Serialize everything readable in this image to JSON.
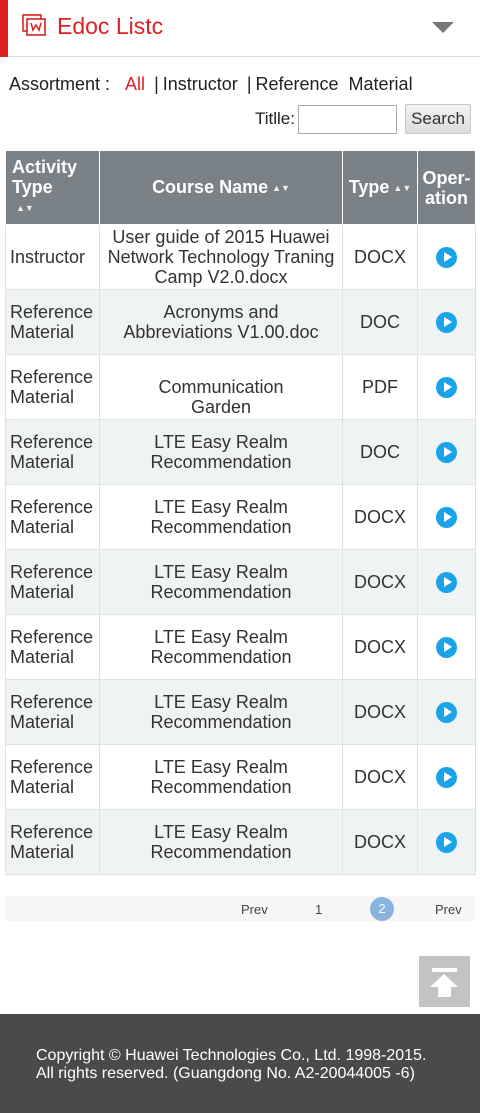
{
  "header": {
    "title": "Edoc Listc"
  },
  "filter": {
    "label": "Assortment :",
    "options": [
      "All",
      "Instructor",
      "Reference  Material"
    ],
    "separator": "|"
  },
  "search": {
    "label": "Titlle:",
    "value": "",
    "placeholder": "",
    "button": "Search"
  },
  "table": {
    "headers": [
      "Activity Type",
      "Course Name",
      "Type",
      "Oper-ation"
    ],
    "rows": [
      {
        "activity": "Instructor",
        "course": "User guide of 2015 Huawei Network Technology Traning Camp V2.0.docx",
        "type": "DOCX"
      },
      {
        "activity": "Reference Material",
        "course": "Acronyms and Abbreviations V1.00.doc",
        "type": "DOC"
      },
      {
        "activity": "Reference Material",
        "course": "Communication Garden",
        "type": "PDF"
      },
      {
        "activity": "Reference Material",
        "course": "LTE Easy Realm Recommendation",
        "type": "DOC"
      },
      {
        "activity": "Reference Material",
        "course": "LTE Easy Realm Recommendation",
        "type": "DOCX"
      },
      {
        "activity": "Reference Material",
        "course": "LTE Easy Realm Recommendation",
        "type": "DOCX"
      },
      {
        "activity": "Reference Material",
        "course": "LTE Easy Realm Recommendation",
        "type": "DOCX"
      },
      {
        "activity": "Reference Material",
        "course": "LTE Easy Realm Recommendation",
        "type": "DOCX"
      },
      {
        "activity": "Reference Material",
        "course": "LTE Easy Realm Recommendation",
        "type": "DOCX"
      },
      {
        "activity": "Reference Material",
        "course": "LTE Easy Realm Recommendation",
        "type": "DOCX"
      }
    ]
  },
  "pager": {
    "prev_label": "Prev",
    "page_1": "1",
    "page_2": "2",
    "next_label": "Prev",
    "current": "2"
  },
  "footer": {
    "line1": "Copyright © Huawei Technologies Co., Ltd. 1998-2015.",
    "line2": "All rights reserved. (Guangdong No. A2-20044005 -6)"
  },
  "colors": {
    "accent": "#e02020",
    "header_bg": "#7a8288",
    "play": "#1aa3ea",
    "footer_bg": "#4a4a4a"
  },
  "icons": [
    "document-icon",
    "chevron-down-icon",
    "sort-icon",
    "play-icon",
    "back-to-top-icon"
  ]
}
